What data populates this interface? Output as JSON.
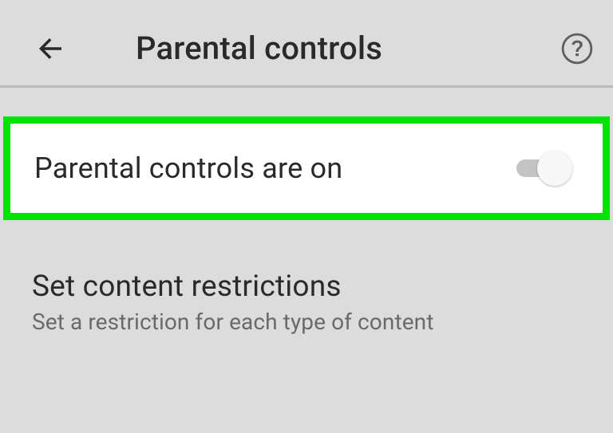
{
  "header": {
    "title": "Parental controls"
  },
  "toggle_row": {
    "label": "Parental controls are on",
    "enabled": true
  },
  "section": {
    "title": "Set content restrictions",
    "subtitle": "Set a restriction for each type of content"
  }
}
